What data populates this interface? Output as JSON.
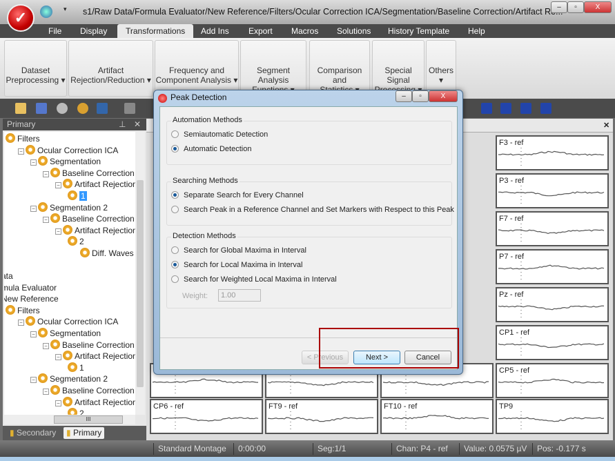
{
  "window": {
    "title": "s1/Raw Data/Formula Evaluator/New Reference/Filters/Ocular Correction ICA/Segmentation/Baseline Correction/Artifact Re...",
    "minimize": "–",
    "maximize": "▫",
    "close": "X"
  },
  "menu": {
    "tabs": [
      "File",
      "Display",
      "Transformations",
      "Add Ins",
      "Export",
      "Macros",
      "Solutions",
      "History Template",
      "Help"
    ],
    "active": "Transformations"
  },
  "ribbon": {
    "groups": [
      {
        "line1": "Dataset",
        "line2": "Preprocessing ▾"
      },
      {
        "line1": "Artifact",
        "line2": "Rejection/Reduction ▾"
      },
      {
        "line1": "Frequency and",
        "line2": "Component Analysis ▾"
      },
      {
        "line1": "Segment Analysis",
        "line2": "Functions ▾"
      },
      {
        "line1": "Comparison and",
        "line2": "Statistics ▾"
      },
      {
        "line1": "Special Signal",
        "line2": "Processing ▾"
      },
      {
        "line1": "Others",
        "line2": "▾"
      }
    ]
  },
  "left_panel": {
    "title": "Primary",
    "pin": "⊥",
    "close": "✕",
    "tree_top": [
      {
        "label": "Filters",
        "indent": 0
      },
      {
        "label": "Ocular Correction ICA",
        "indent": 1
      },
      {
        "label": "Segmentation",
        "indent": 2
      },
      {
        "label": "Baseline Correction",
        "indent": 3
      },
      {
        "label": "Artifact Rejection",
        "indent": 4
      },
      {
        "label": "1",
        "indent": 5,
        "selected": true
      },
      {
        "label": "Segmentation 2",
        "indent": 2
      },
      {
        "label": "Baseline Correction",
        "indent": 3
      },
      {
        "label": "Artifact Rejection",
        "indent": 4
      },
      {
        "label": "2",
        "indent": 5
      },
      {
        "label": "Diff. Waves",
        "indent": 6
      }
    ],
    "tree_bottom": [
      {
        "label": "ata",
        "indent": -1,
        "noicon": true
      },
      {
        "label": "mula Evaluator",
        "indent": -1,
        "noicon": true
      },
      {
        "label": "New Reference",
        "indent": -1,
        "noicon": true
      },
      {
        "label": "Filters",
        "indent": 0
      },
      {
        "label": "Ocular Correction ICA",
        "indent": 1
      },
      {
        "label": "Segmentation",
        "indent": 2
      },
      {
        "label": "Baseline Correction",
        "indent": 3
      },
      {
        "label": "Artifact Rejection",
        "indent": 4
      },
      {
        "label": "1",
        "indent": 5
      },
      {
        "label": "Segmentation 2",
        "indent": 2
      },
      {
        "label": "Baseline Correction",
        "indent": 3
      },
      {
        "label": "Artifact Rejection",
        "indent": 4
      },
      {
        "label": "2",
        "indent": 5
      }
    ],
    "bottom_tabs": [
      "Secondary",
      "Primary"
    ],
    "hscroll_grip": "III"
  },
  "content": {
    "close": "✕",
    "right_column_labels": [
      "F3 - ref",
      "P3 - ref",
      "F7 - ref",
      "P7 - ref",
      "Pz - ref",
      "CP1 - ref",
      "CP5 - ref"
    ],
    "bottom_row_labels": [
      "CP6 - ref",
      "FT9 - ref",
      "FT10 - ref",
      "TP9"
    ]
  },
  "dialog": {
    "title": "Peak Detection",
    "automation": {
      "legend": "Automation Methods",
      "options": [
        {
          "label": "Semiautomatic Detection",
          "checked": false
        },
        {
          "label": "Automatic Detection",
          "checked": true
        }
      ]
    },
    "searching": {
      "legend": "Searching Methods",
      "options": [
        {
          "label": "Separate Search for Every Channel",
          "checked": true
        },
        {
          "label": "Search Peak in a Reference Channel and Set Markers with Respect to this Peak",
          "checked": false
        }
      ]
    },
    "detection": {
      "legend": "Detection Methods",
      "options": [
        {
          "label": "Search for Global Maxima in Interval",
          "checked": false
        },
        {
          "label": "Search for Local Maxima in Interval",
          "checked": true
        },
        {
          "label": "Search for Weighted Local Maxima in Interval",
          "checked": false
        }
      ],
      "weight_label": "Weight:",
      "weight_value": "1.00"
    },
    "buttons": {
      "previous": "< Previous",
      "next": "Next >",
      "cancel": "Cancel"
    }
  },
  "status": {
    "montage": "Standard Montage",
    "time": "0:00:00",
    "segment": "Seg:1/1",
    "channel": "Chan:  P4 - ref",
    "value": "Value: 0.0575 µV",
    "position": "Pos:  -0.177 s"
  },
  "colors": {
    "highlight_box": "#aa0000",
    "selection": "#3399ff",
    "toolbar": "#4b4b4b"
  }
}
